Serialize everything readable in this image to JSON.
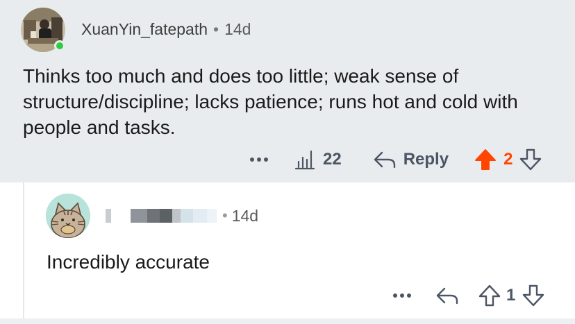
{
  "parent_comment": {
    "username": "XuanYin_fatepath",
    "separator": "•",
    "time": "14d",
    "text": "Thinks too much and does too little; weak sense of structure/discipline; lacks patience; runs hot and cold with people and tasks.",
    "views": "22",
    "reply_label": "Reply",
    "vote_count": "2",
    "vote_color": "#ff4500"
  },
  "child_comment": {
    "username_redacted": "",
    "separator": "•",
    "time": "14d",
    "text": "Incredibly accurate",
    "vote_count": "1"
  },
  "icons": {
    "more": "more-icon",
    "views": "bar-chart-icon",
    "reply": "reply-arrow-icon",
    "upvote": "upvote-arrow-icon",
    "downvote": "downvote-arrow-icon"
  }
}
